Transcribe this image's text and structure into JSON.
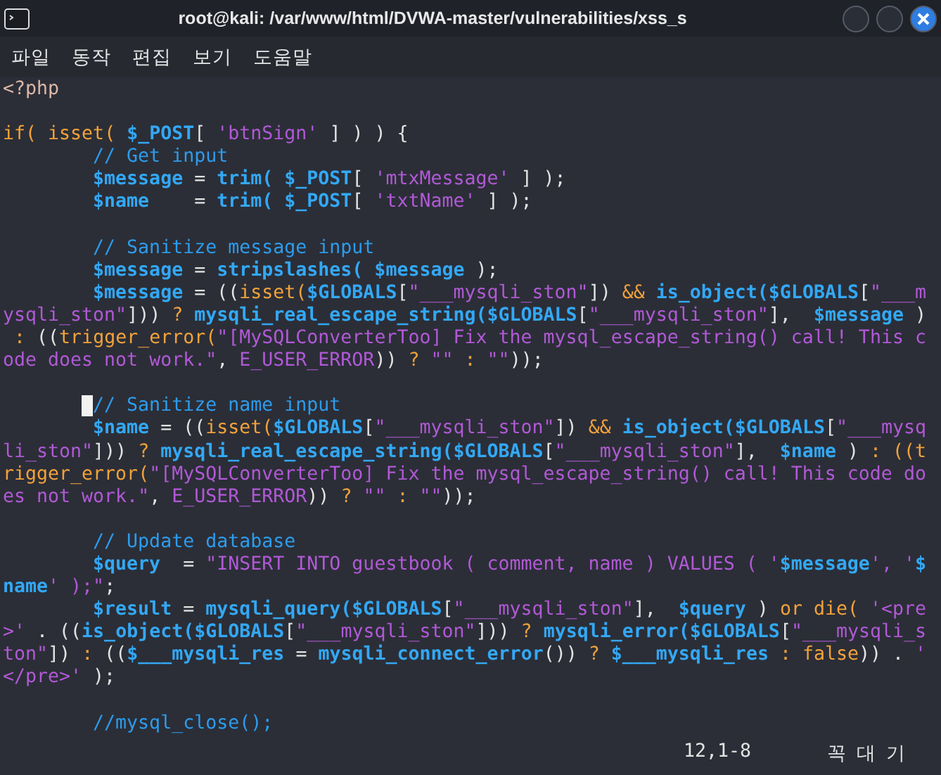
{
  "window": {
    "title": "root@kali: /var/www/html/DVWA-master/vulnerabilities/xss_s"
  },
  "menu": [
    "파일",
    "동작",
    "편집",
    "보기",
    "도움말"
  ],
  "editor": {
    "rows": [
      {
        "tokens": [
          {
            "kind": "tag",
            "text": "<?php"
          }
        ]
      },
      {
        "gap_before": true,
        "tokens": [
          {
            "kind": "kw",
            "text": "if("
          },
          {
            "kind": "kw",
            "text": " isset("
          },
          {
            "kind": "var",
            "text": " $_POST"
          },
          {
            "kind": "plain",
            "text": "[ "
          },
          {
            "kind": "str",
            "text": "'btnSign'"
          },
          {
            "kind": "plain",
            "text": " ] ) ) {"
          }
        ]
      },
      {
        "indented": true,
        "tokens": [
          {
            "kind": "cmt",
            "text": "// Get input"
          }
        ]
      },
      {
        "indented": true,
        "tokens": [
          {
            "kind": "var",
            "text": "$message"
          },
          {
            "kind": "plain",
            "text": " = "
          },
          {
            "kind": "fn",
            "text": "trim( $_POST"
          },
          {
            "kind": "plain",
            "text": "[ "
          },
          {
            "kind": "str",
            "text": "'mtxMessage'"
          },
          {
            "kind": "plain",
            "text": " ] );"
          }
        ]
      },
      {
        "indented": true,
        "tokens": [
          {
            "kind": "var",
            "text": "$name"
          },
          {
            "kind": "plain",
            "text": "    = "
          },
          {
            "kind": "fn",
            "text": "trim( $_POST"
          },
          {
            "kind": "plain",
            "text": "[ "
          },
          {
            "kind": "str",
            "text": "'txtName'"
          },
          {
            "kind": "plain",
            "text": " ] );"
          }
        ]
      },
      {
        "indented": true,
        "gap_before": true,
        "tokens": [
          {
            "kind": "cmt",
            "text": "// Sanitize message input"
          }
        ]
      },
      {
        "indented": true,
        "tokens": [
          {
            "kind": "var",
            "text": "$message"
          },
          {
            "kind": "plain",
            "text": " = "
          },
          {
            "kind": "fn",
            "text": "stripslashes( $message"
          },
          {
            "kind": "plain",
            "text": " );"
          }
        ]
      },
      {
        "indented": true,
        "tokens": [
          {
            "kind": "var",
            "text": "$message"
          },
          {
            "kind": "plain",
            "text": " = (("
          },
          {
            "kind": "kw",
            "text": "isset("
          },
          {
            "kind": "var",
            "text": "$GLOBALS"
          },
          {
            "kind": "plain",
            "text": "["
          },
          {
            "kind": "str",
            "text": "\"___mysqli_ston\""
          },
          {
            "kind": "plain",
            "text": "]) "
          },
          {
            "kind": "kw",
            "text": "&& "
          },
          {
            "kind": "fn",
            "text": "is_object($GLOBALS"
          },
          {
            "kind": "plain",
            "text": "["
          },
          {
            "kind": "str",
            "text": "\"___m"
          }
        ]
      },
      {
        "tokens": [
          {
            "kind": "str",
            "text": "ysqli_ston\""
          },
          {
            "kind": "plain",
            "text": "])) "
          },
          {
            "kind": "kw",
            "text": "? "
          },
          {
            "kind": "fn",
            "text": "mysqli_real_escape_string($GLOBALS"
          },
          {
            "kind": "plain",
            "text": "["
          },
          {
            "kind": "str",
            "text": "\"___mysqli_ston\""
          },
          {
            "kind": "plain",
            "text": "],  "
          },
          {
            "kind": "var",
            "text": "$message"
          },
          {
            "kind": "plain",
            "text": " )"
          }
        ]
      },
      {
        "tokens": [
          {
            "kind": "kw",
            "text": " :"
          },
          {
            "kind": "plain",
            "text": " (("
          },
          {
            "kind": "kw",
            "text": "trigger_error("
          },
          {
            "kind": "str",
            "text": "\"[MySQLConverterToo] Fix the mysql_escape_string() call! This c"
          }
        ]
      },
      {
        "tokens": [
          {
            "kind": "str",
            "text": "ode does not work.\""
          },
          {
            "kind": "plain",
            "text": ", "
          },
          {
            "kind": "str",
            "text": "E_USER_ERROR"
          },
          {
            "kind": "plain",
            "text": "))"
          },
          {
            "kind": "kw",
            "text": " ? "
          },
          {
            "kind": "str",
            "text": "\"\""
          },
          {
            "kind": "kw",
            "text": " : "
          },
          {
            "kind": "str",
            "text": "\"\""
          },
          {
            "kind": "plain",
            "text": "));"
          }
        ]
      },
      {
        "indented": true,
        "gap_before": true,
        "cursor": true,
        "tokens": [
          {
            "kind": "cmt",
            "text": "// Sanitize name input"
          }
        ]
      },
      {
        "indented": true,
        "tokens": [
          {
            "kind": "var",
            "text": "$name"
          },
          {
            "kind": "plain",
            "text": " = (("
          },
          {
            "kind": "kw",
            "text": "isset("
          },
          {
            "kind": "var",
            "text": "$GLOBALS"
          },
          {
            "kind": "plain",
            "text": "["
          },
          {
            "kind": "str",
            "text": "\"___mysqli_ston\""
          },
          {
            "kind": "plain",
            "text": "]) "
          },
          {
            "kind": "kw",
            "text": "&& "
          },
          {
            "kind": "fn",
            "text": "is_object($GLOBALS"
          },
          {
            "kind": "plain",
            "text": "["
          },
          {
            "kind": "str",
            "text": "\"___mysq"
          }
        ]
      },
      {
        "tokens": [
          {
            "kind": "str",
            "text": "li_ston\""
          },
          {
            "kind": "plain",
            "text": "])) "
          },
          {
            "kind": "kw",
            "text": "? "
          },
          {
            "kind": "fn",
            "text": "mysqli_real_escape_string($GLOBALS"
          },
          {
            "kind": "plain",
            "text": "["
          },
          {
            "kind": "str",
            "text": "\"___mysqli_ston\""
          },
          {
            "kind": "plain",
            "text": "],  "
          },
          {
            "kind": "var",
            "text": "$name"
          },
          {
            "kind": "plain",
            "text": " ) "
          },
          {
            "kind": "kw",
            "text": ": ((t"
          }
        ]
      },
      {
        "tokens": [
          {
            "kind": "kw",
            "text": "rigger_error("
          },
          {
            "kind": "str",
            "text": "\"[MySQLConverterToo] Fix the mysql_escape_string() call! This code do"
          }
        ]
      },
      {
        "tokens": [
          {
            "kind": "str",
            "text": "es not work.\""
          },
          {
            "kind": "plain",
            "text": ", "
          },
          {
            "kind": "str",
            "text": "E_USER_ERROR"
          },
          {
            "kind": "plain",
            "text": "))"
          },
          {
            "kind": "kw",
            "text": " ? "
          },
          {
            "kind": "str",
            "text": "\"\""
          },
          {
            "kind": "kw",
            "text": " : "
          },
          {
            "kind": "str",
            "text": "\"\""
          },
          {
            "kind": "plain",
            "text": "));"
          }
        ]
      },
      {
        "indented": true,
        "gap_before": true,
        "tokens": [
          {
            "kind": "cmt",
            "text": "// Update database"
          }
        ]
      },
      {
        "indented": true,
        "tokens": [
          {
            "kind": "var",
            "text": "$query"
          },
          {
            "kind": "plain",
            "text": "  = "
          },
          {
            "kind": "str",
            "text": "\"INSERT INTO guestbook ( comment, name ) VALUES ( '"
          },
          {
            "kind": "var",
            "text": "$message"
          },
          {
            "kind": "str",
            "text": "', '"
          },
          {
            "kind": "var",
            "text": "$"
          }
        ]
      },
      {
        "tokens": [
          {
            "kind": "var",
            "text": "name"
          },
          {
            "kind": "str",
            "text": "' );\""
          },
          {
            "kind": "plain",
            "text": ";"
          }
        ]
      },
      {
        "indented": true,
        "tokens": [
          {
            "kind": "var",
            "text": "$result"
          },
          {
            "kind": "plain",
            "text": " = "
          },
          {
            "kind": "fn",
            "text": "mysqli_query($GLOBALS"
          },
          {
            "kind": "plain",
            "text": "["
          },
          {
            "kind": "str",
            "text": "\"___mysqli_ston\""
          },
          {
            "kind": "plain",
            "text": "],  "
          },
          {
            "kind": "var",
            "text": "$query"
          },
          {
            "kind": "plain",
            "text": " ) "
          },
          {
            "kind": "kw",
            "text": "or die( "
          },
          {
            "kind": "str",
            "text": "'<pre"
          }
        ]
      },
      {
        "tokens": [
          {
            "kind": "str",
            "text": ">'"
          },
          {
            "kind": "plain",
            "text": " . (("
          },
          {
            "kind": "fn",
            "text": "is_object($GLOBALS"
          },
          {
            "kind": "plain",
            "text": "["
          },
          {
            "kind": "str",
            "text": "\"___mysqli_ston\""
          },
          {
            "kind": "plain",
            "text": "])) "
          },
          {
            "kind": "kw",
            "text": "? "
          },
          {
            "kind": "fn",
            "text": "mysqli_error($GLOBALS"
          },
          {
            "kind": "plain",
            "text": "["
          },
          {
            "kind": "str",
            "text": "\"___mysqli_s"
          }
        ]
      },
      {
        "tokens": [
          {
            "kind": "str",
            "text": "ton\""
          },
          {
            "kind": "plain",
            "text": "]) "
          },
          {
            "kind": "kw",
            "text": ":"
          },
          {
            "kind": "plain",
            "text": " (("
          },
          {
            "kind": "var",
            "text": "$___mysqli_res"
          },
          {
            "kind": "plain",
            "text": " = "
          },
          {
            "kind": "fn",
            "text": "mysqli_connect_error"
          },
          {
            "kind": "plain",
            "text": "()) "
          },
          {
            "kind": "kw",
            "text": "? "
          },
          {
            "kind": "var",
            "text": "$___mysqli_res"
          },
          {
            "kind": "kw",
            "text": " : false"
          },
          {
            "kind": "plain",
            "text": ")) . "
          },
          {
            "kind": "str",
            "text": "'"
          }
        ]
      },
      {
        "tokens": [
          {
            "kind": "str",
            "text": "</pre>'"
          },
          {
            "kind": "plain",
            "text": " );"
          }
        ]
      },
      {
        "indented": true,
        "gap_before": true,
        "tokens": [
          {
            "kind": "cmt",
            "text": "//mysql_close();"
          }
        ]
      }
    ]
  },
  "status": {
    "position": "12,1-8",
    "scroll": "꼭 대 기"
  }
}
